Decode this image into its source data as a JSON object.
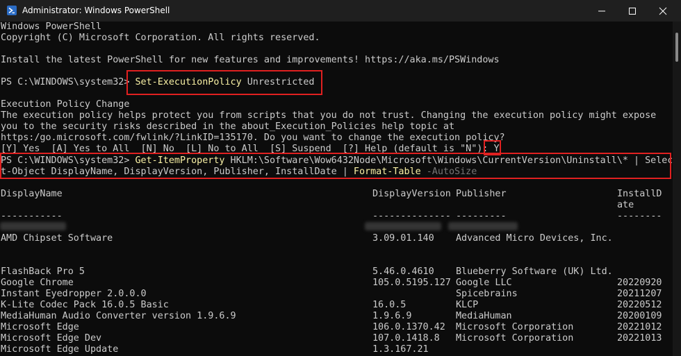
{
  "window": {
    "title": "Administrator: Windows PowerShell"
  },
  "console": {
    "header": [
      "Windows PowerShell",
      "Copyright (C) Microsoft Corporation. All rights reserved.",
      "",
      "Install the latest PowerShell for new features and improvements! https://aka.ms/PSWindows"
    ],
    "prompt": "PS C:\\WINDOWS\\system32> ",
    "command1": {
      "cmdlet": "Set-ExecutionPolicy",
      "arg": " Unrestricted"
    },
    "policy_change": [
      "Execution Policy Change",
      "The execution policy helps protect you from scripts that you do not trust. Changing the execution policy might expose",
      "you to the security risks described in the about_Execution_Policies help topic at",
      "https:/go.microsoft.com/fwlink/?LinkID=135170. Do you want to change the execution policy?"
    ],
    "choices": "[Y] Yes  [A] Yes to All  [N] No  [L] No to All  [S] Suspend  [?] Help (default is \"N\"): ",
    "answer": "Y",
    "command2": {
      "line1_cmdlet": "Get-ItemProperty",
      "line1_rest": " HKLM:\\Software\\Wow6432Node\\Microsoft\\Windows\\CurrentVersion\\Uninstall\\* | Selec",
      "line2_start": "t-Object DisplayName, DisplayVersion, Publisher, InstallDate | ",
      "line2_cmdlet": "Format-Table",
      "line2_param": " -AutoSize"
    },
    "table": {
      "headers": {
        "name": "DisplayName",
        "version": "DisplayVersion",
        "publisher": "Publisher",
        "date1": "InstallD",
        "date2": "ate"
      },
      "separators": {
        "name": "-----------",
        "version": "--------------",
        "publisher": "---------",
        "date": "--------"
      },
      "rows": [
        {
          "name": "AMD Chipset Software",
          "version": "3.09.01.140",
          "publisher": "Advanced Micro Devices, Inc.",
          "date": ""
        },
        {
          "name": "",
          "version": "",
          "publisher": "",
          "date": ""
        },
        {
          "name": "FlashBack Pro 5",
          "version": "5.46.0.4610",
          "publisher": "Blueberry Software (UK) Ltd.",
          "date": ""
        },
        {
          "name": "Google Chrome",
          "version": "105.0.5195.127",
          "publisher": "Google LLC",
          "date": "20220920"
        },
        {
          "name": "Instant Eyedropper 2.0.0.0",
          "version": "",
          "publisher": "Spicebrains",
          "date": "20211207"
        },
        {
          "name": "K-Lite Codec Pack 16.0.5 Basic",
          "version": "16.0.5",
          "publisher": "KLCP",
          "date": "20220512"
        },
        {
          "name": "MediaHuman Audio Converter version 1.9.6.9",
          "version": "1.9.6.9",
          "publisher": "MediaHuman",
          "date": "20200109"
        },
        {
          "name": "Microsoft Edge",
          "version": "106.0.1370.42",
          "publisher": "Microsoft Corporation",
          "date": "20221012"
        },
        {
          "name": "Microsoft Edge Dev",
          "version": "107.0.1418.8",
          "publisher": "Microsoft Corporation",
          "date": "20221013"
        },
        {
          "name": "Microsoft Edge Update",
          "version": "1.3.167.21",
          "publisher": "",
          "date": ""
        }
      ]
    }
  },
  "colors": {
    "background": "#0c0c0c",
    "text": "#cccccc",
    "cmdlet": "#f9f1a5",
    "parameter": "#767676",
    "highlight_box": "#e02020"
  }
}
